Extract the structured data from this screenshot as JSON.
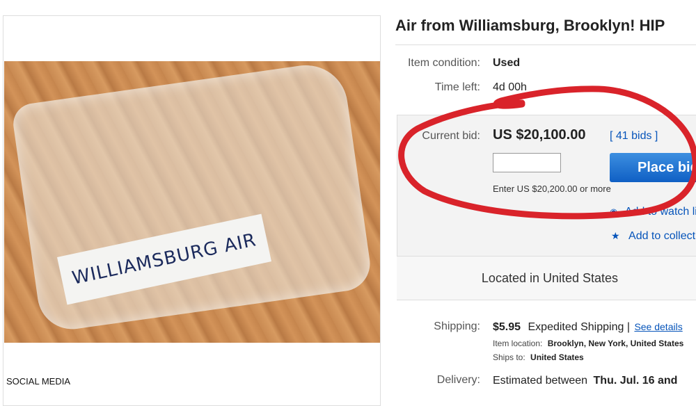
{
  "listing": {
    "title": "Air from Williamsburg, Brooklyn! HIP",
    "photo_label": "WILLIAMSBURG AIR",
    "watermark": "SOCIAL MEDIA"
  },
  "details": {
    "condition_label": "Item condition:",
    "condition_value": "Used",
    "time_left_label": "Time left:",
    "time_left_value": "4d 00h"
  },
  "bidding": {
    "current_bid_label": "Current bid:",
    "current_bid_value": "US $20,100.00",
    "bids_count": "[ 41 bids ]",
    "input_value": "",
    "place_bid_label": "Place bid",
    "enter_hint": "Enter US $20,200.00 or more",
    "add_watch_label": "Add to watch list",
    "add_collection_label": "Add to collection",
    "located": "Located in United States"
  },
  "shipping": {
    "label": "Shipping:",
    "price": "$5.95",
    "method": "Expedited Shipping |",
    "see_details": "See details",
    "item_location_label": "Item location:",
    "item_location_value": "Brooklyn, New York, United States",
    "ships_to_label": "Ships to:",
    "ships_to_value": "United States"
  },
  "delivery": {
    "label": "Delivery:",
    "value_prefix": "Estimated between",
    "value_bold": "Thu. Jul. 16 and"
  },
  "colors": {
    "link": "#0654ba",
    "button": "#0f5fc4",
    "annotation": "#d9232a"
  },
  "icons": [
    "star-icon",
    "eye-icon"
  ]
}
